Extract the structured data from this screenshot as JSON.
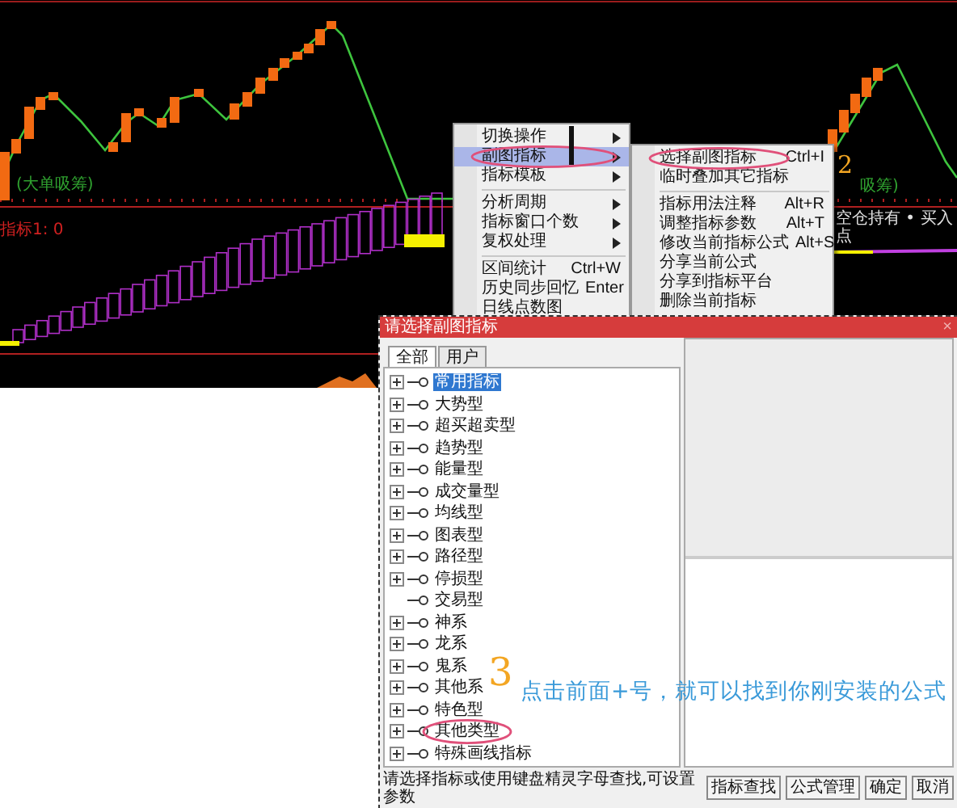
{
  "chart": {
    "signal_label": "(大单吸筹)",
    "indicator_label": "指标1: 0",
    "right_signal_label": "吸筹)",
    "right_indicator_label": "空仓持有 • 买入点"
  },
  "context_menu": {
    "items": [
      {
        "kind": "item",
        "label": "切换操作",
        "submenu": true,
        "selected": false,
        "circled": false
      },
      {
        "kind": "item",
        "label": "副图指标",
        "submenu": true,
        "selected": true,
        "circled": true
      },
      {
        "kind": "item",
        "label": "指标模板",
        "submenu": true,
        "selected": false,
        "circled": false
      },
      {
        "kind": "separator"
      },
      {
        "kind": "item",
        "label": "分析周期",
        "submenu": true,
        "selected": false,
        "circled": false
      },
      {
        "kind": "item",
        "label": "指标窗口个数",
        "submenu": true,
        "selected": false,
        "circled": false
      },
      {
        "kind": "item",
        "label": "复权处理",
        "submenu": true,
        "selected": false,
        "circled": false
      },
      {
        "kind": "separator"
      },
      {
        "kind": "item",
        "label": "区间统计",
        "shortcut": "Ctrl+W",
        "submenu": false,
        "selected": false,
        "circled": false
      },
      {
        "kind": "item",
        "label": "历史同步回忆",
        "shortcut": "Enter",
        "submenu": false,
        "selected": false,
        "circled": false
      },
      {
        "kind": "item",
        "label": "日线点数图",
        "submenu": false,
        "selected": false,
        "circled": false
      }
    ]
  },
  "submenu": {
    "items": [
      {
        "kind": "item",
        "label": "选择副图指标",
        "shortcut": "Ctrl+I",
        "selected": false,
        "circled": true
      },
      {
        "kind": "item",
        "label": "临时叠加其它指标",
        "selected": false,
        "circled": false
      },
      {
        "kind": "separator"
      },
      {
        "kind": "item",
        "label": "指标用法注释",
        "shortcut": "Alt+R",
        "selected": false,
        "circled": false
      },
      {
        "kind": "item",
        "label": "调整指标参数",
        "shortcut": "Alt+T",
        "selected": false,
        "circled": false
      },
      {
        "kind": "item",
        "label": "修改当前指标公式",
        "shortcut": "Alt+S",
        "selected": false,
        "circled": false
      },
      {
        "kind": "item",
        "label": "分享当前公式",
        "selected": false,
        "circled": false
      },
      {
        "kind": "item",
        "label": "分享到指标平台",
        "selected": false,
        "circled": false
      },
      {
        "kind": "item",
        "label": "删除当前指标",
        "selected": false,
        "circled": false
      }
    ]
  },
  "dialog": {
    "title": "请选择副图指标",
    "close": "×",
    "tabs": [
      {
        "label": "全部",
        "selected": true
      },
      {
        "label": "用户",
        "selected": false
      }
    ],
    "tree": [
      {
        "label": "常用指标",
        "kind": "group",
        "selected": true,
        "circled": false
      },
      {
        "label": "大势型",
        "kind": "group",
        "selected": false,
        "circled": false
      },
      {
        "label": "超买超卖型",
        "kind": "group",
        "selected": false,
        "circled": false
      },
      {
        "label": "趋势型",
        "kind": "group",
        "selected": false,
        "circled": false
      },
      {
        "label": "能量型",
        "kind": "group",
        "selected": false,
        "circled": false
      },
      {
        "label": "成交量型",
        "kind": "group",
        "selected": false,
        "circled": false
      },
      {
        "label": "均线型",
        "kind": "group",
        "selected": false,
        "circled": false
      },
      {
        "label": "图表型",
        "kind": "group",
        "selected": false,
        "circled": false
      },
      {
        "label": "路径型",
        "kind": "group",
        "selected": false,
        "circled": false
      },
      {
        "label": "停损型",
        "kind": "group",
        "selected": false,
        "circled": false
      },
      {
        "label": "交易型",
        "kind": "leaf",
        "selected": false,
        "circled": false
      },
      {
        "label": "神系",
        "kind": "group",
        "selected": false,
        "circled": false
      },
      {
        "label": "龙系",
        "kind": "group",
        "selected": false,
        "circled": false
      },
      {
        "label": "鬼系",
        "kind": "group",
        "selected": false,
        "circled": false
      },
      {
        "label": "其他系",
        "kind": "group",
        "selected": false,
        "circled": false
      },
      {
        "label": "特色型",
        "kind": "group",
        "selected": false,
        "circled": false
      },
      {
        "label": "其他类型",
        "kind": "group",
        "selected": false,
        "circled": true
      },
      {
        "label": "特殊画线指标",
        "kind": "group",
        "selected": false,
        "circled": false
      }
    ],
    "status_text": "请选择指标或使用键盘精灵字母查找,可设置参数",
    "buttons": [
      "指标查找",
      "公式管理",
      "确定",
      "取消"
    ]
  },
  "annotations": {
    "step_two": "2",
    "step_three": "3",
    "hint": "点击前面+号，就可以找到你刚安装的公式"
  }
}
